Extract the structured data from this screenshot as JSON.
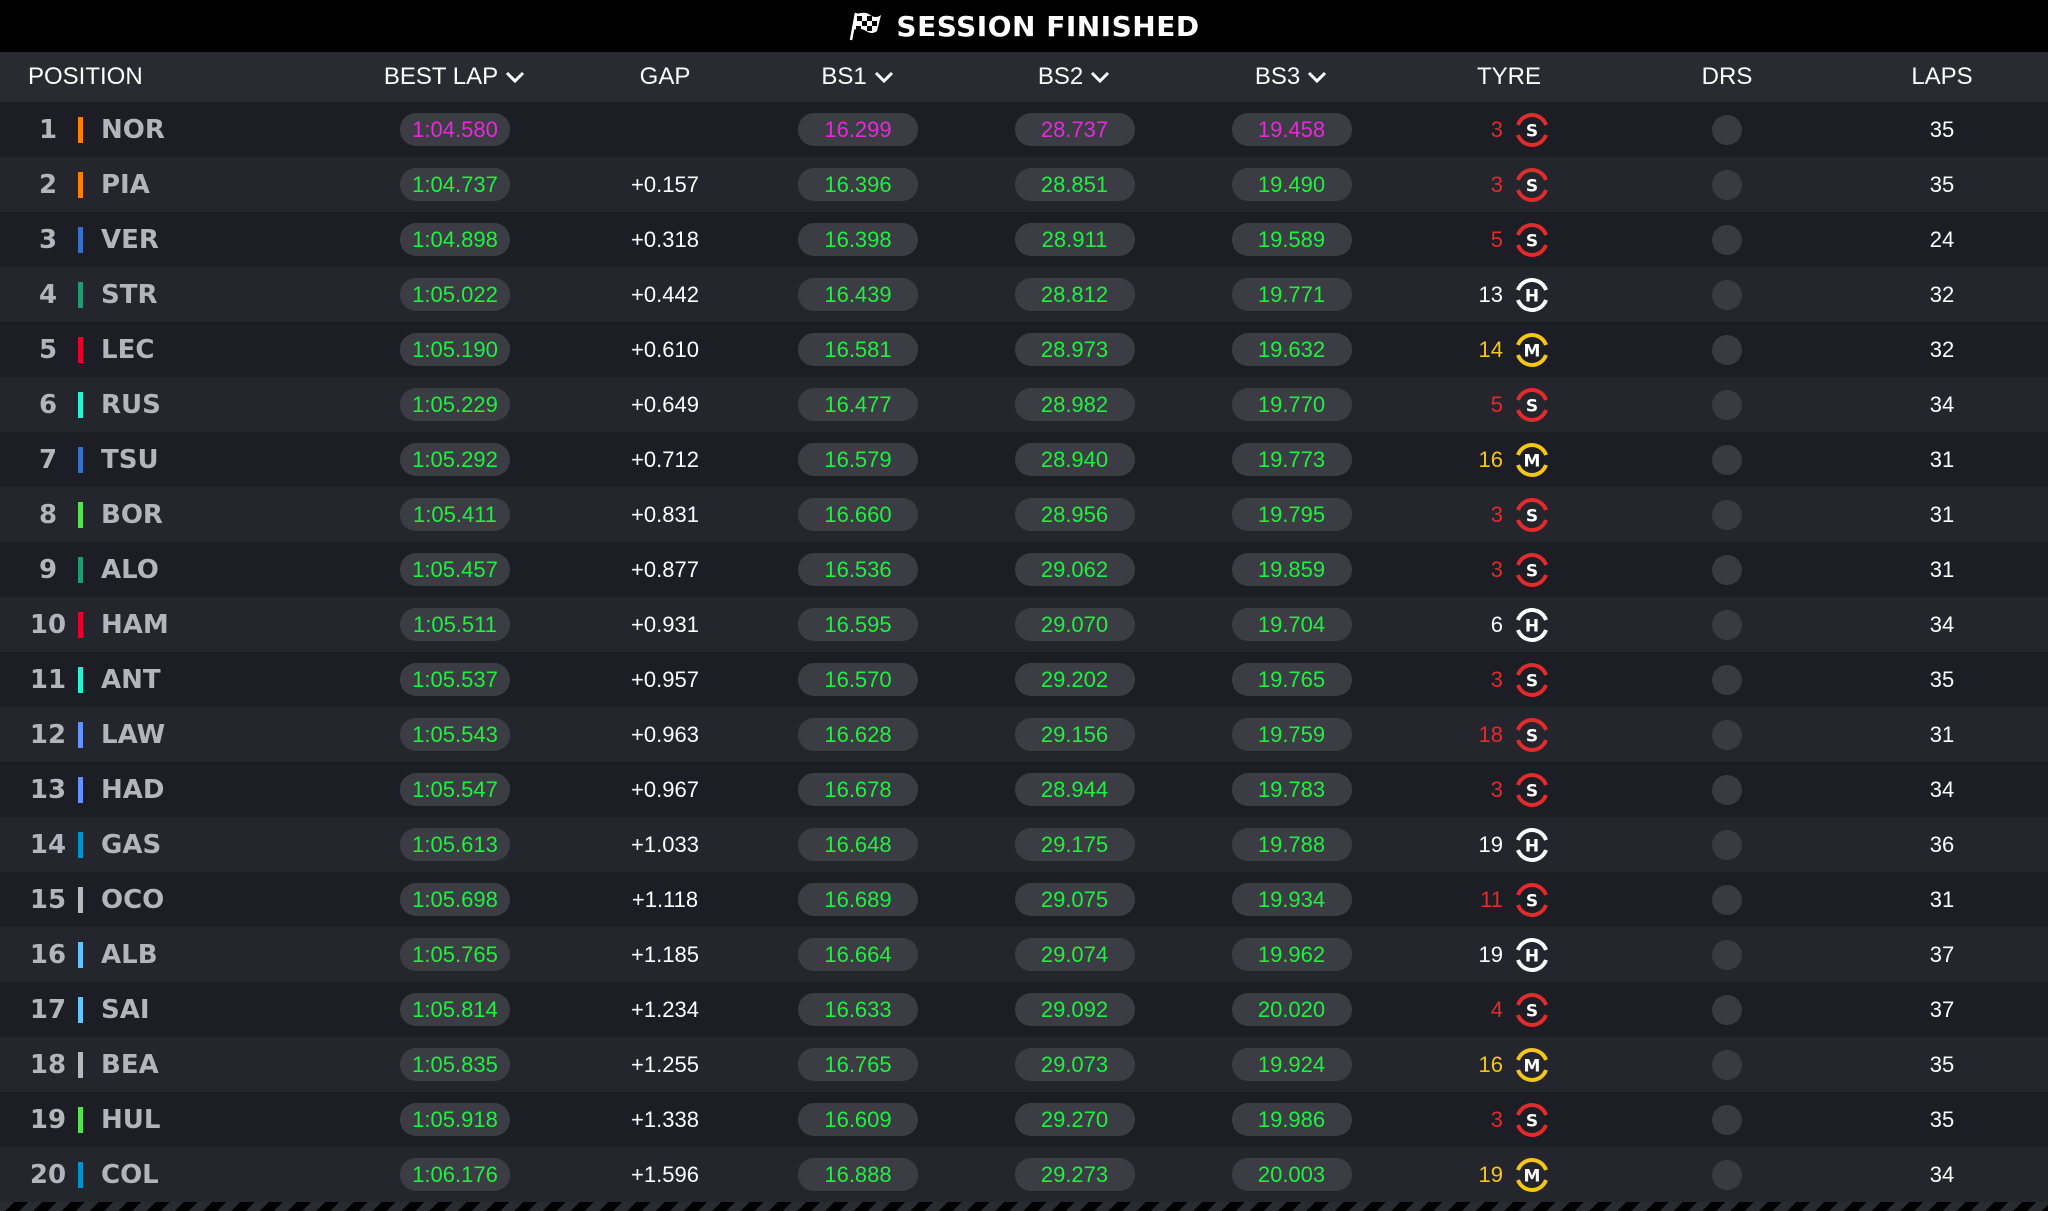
{
  "title": "SESSION FINISHED",
  "headers": {
    "position": "POSITION",
    "best_lap": "BEST LAP",
    "gap": "GAP",
    "bs1": "BS1",
    "bs2": "BS2",
    "bs3": "BS3",
    "tyre": "TYRE",
    "drs": "DRS",
    "laps": "LAPS"
  },
  "colors": {
    "green": "#1ff03f",
    "purple": "#e52ad9",
    "soft": "#e22b2b",
    "medium": "#f5c518",
    "hard": "#ffffff"
  },
  "drivers": [
    {
      "pos": "1",
      "code": "NOR",
      "team_color": "#ff8000",
      "best": "1:04.580",
      "best_purple": true,
      "gap": "",
      "bs1": "16.299",
      "bs1_purple": true,
      "bs2": "28.737",
      "bs2_purple": true,
      "bs3": "19.458",
      "bs3_purple": true,
      "tyre_age": "3",
      "tyre": "S",
      "laps": "35"
    },
    {
      "pos": "2",
      "code": "PIA",
      "team_color": "#ff8000",
      "best": "1:04.737",
      "gap": "+0.157",
      "bs1": "16.396",
      "bs2": "28.851",
      "bs3": "19.490",
      "tyre_age": "3",
      "tyre": "S",
      "laps": "35"
    },
    {
      "pos": "3",
      "code": "VER",
      "team_color": "#3671c6",
      "best": "1:04.898",
      "gap": "+0.318",
      "bs1": "16.398",
      "bs2": "28.911",
      "bs3": "19.589",
      "tyre_age": "5",
      "tyre": "S",
      "laps": "24"
    },
    {
      "pos": "4",
      "code": "STR",
      "team_color": "#229971",
      "best": "1:05.022",
      "gap": "+0.442",
      "bs1": "16.439",
      "bs2": "28.812",
      "bs3": "19.771",
      "tyre_age": "13",
      "tyre": "H",
      "laps": "32"
    },
    {
      "pos": "5",
      "code": "LEC",
      "team_color": "#e8002d",
      "best": "1:05.190",
      "gap": "+0.610",
      "bs1": "16.581",
      "bs2": "28.973",
      "bs3": "19.632",
      "tyre_age": "14",
      "tyre": "M",
      "laps": "32"
    },
    {
      "pos": "6",
      "code": "RUS",
      "team_color": "#27f4d2",
      "best": "1:05.229",
      "gap": "+0.649",
      "bs1": "16.477",
      "bs2": "28.982",
      "bs3": "19.770",
      "tyre_age": "5",
      "tyre": "S",
      "laps": "34"
    },
    {
      "pos": "7",
      "code": "TSU",
      "team_color": "#3671c6",
      "best": "1:05.292",
      "gap": "+0.712",
      "bs1": "16.579",
      "bs2": "28.940",
      "bs3": "19.773",
      "tyre_age": "16",
      "tyre": "M",
      "laps": "31"
    },
    {
      "pos": "8",
      "code": "BOR",
      "team_color": "#52e252",
      "best": "1:05.411",
      "gap": "+0.831",
      "bs1": "16.660",
      "bs2": "28.956",
      "bs3": "19.795",
      "tyre_age": "3",
      "tyre": "S",
      "laps": "31"
    },
    {
      "pos": "9",
      "code": "ALO",
      "team_color": "#229971",
      "best": "1:05.457",
      "gap": "+0.877",
      "bs1": "16.536",
      "bs2": "29.062",
      "bs3": "19.859",
      "tyre_age": "3",
      "tyre": "S",
      "laps": "31"
    },
    {
      "pos": "10",
      "code": "HAM",
      "team_color": "#e8002d",
      "best": "1:05.511",
      "gap": "+0.931",
      "bs1": "16.595",
      "bs2": "29.070",
      "bs3": "19.704",
      "tyre_age": "6",
      "tyre": "H",
      "laps": "34"
    },
    {
      "pos": "11",
      "code": "ANT",
      "team_color": "#27f4d2",
      "best": "1:05.537",
      "gap": "+0.957",
      "bs1": "16.570",
      "bs2": "29.202",
      "bs3": "19.765",
      "tyre_age": "3",
      "tyre": "S",
      "laps": "35"
    },
    {
      "pos": "12",
      "code": "LAW",
      "team_color": "#6692ff",
      "best": "1:05.543",
      "gap": "+0.963",
      "bs1": "16.628",
      "bs2": "29.156",
      "bs3": "19.759",
      "tyre_age": "18",
      "tyre": "S",
      "laps": "31"
    },
    {
      "pos": "13",
      "code": "HAD",
      "team_color": "#6692ff",
      "best": "1:05.547",
      "gap": "+0.967",
      "bs1": "16.678",
      "bs2": "28.944",
      "bs3": "19.783",
      "tyre_age": "3",
      "tyre": "S",
      "laps": "34"
    },
    {
      "pos": "14",
      "code": "GAS",
      "team_color": "#0093cc",
      "best": "1:05.613",
      "gap": "+1.033",
      "bs1": "16.648",
      "bs2": "29.175",
      "bs3": "19.788",
      "tyre_age": "19",
      "tyre": "H",
      "laps": "36"
    },
    {
      "pos": "15",
      "code": "OCO",
      "team_color": "#b6babd",
      "best": "1:05.698",
      "gap": "+1.118",
      "bs1": "16.689",
      "bs2": "29.075",
      "bs3": "19.934",
      "tyre_age": "11",
      "tyre": "S",
      "laps": "31"
    },
    {
      "pos": "16",
      "code": "ALB",
      "team_color": "#64c4ff",
      "best": "1:05.765",
      "gap": "+1.185",
      "bs1": "16.664",
      "bs2": "29.074",
      "bs3": "19.962",
      "tyre_age": "19",
      "tyre": "H",
      "laps": "37"
    },
    {
      "pos": "17",
      "code": "SAI",
      "team_color": "#64c4ff",
      "best": "1:05.814",
      "gap": "+1.234",
      "bs1": "16.633",
      "bs2": "29.092",
      "bs3": "20.020",
      "tyre_age": "4",
      "tyre": "S",
      "laps": "37"
    },
    {
      "pos": "18",
      "code": "BEA",
      "team_color": "#b6babd",
      "best": "1:05.835",
      "gap": "+1.255",
      "bs1": "16.765",
      "bs2": "29.073",
      "bs3": "19.924",
      "tyre_age": "16",
      "tyre": "M",
      "laps": "35"
    },
    {
      "pos": "19",
      "code": "HUL",
      "team_color": "#52e252",
      "best": "1:05.918",
      "gap": "+1.338",
      "bs1": "16.609",
      "bs2": "29.270",
      "bs3": "19.986",
      "tyre_age": "3",
      "tyre": "S",
      "laps": "35"
    },
    {
      "pos": "20",
      "code": "COL",
      "team_color": "#0093cc",
      "best": "1:06.176",
      "gap": "+1.596",
      "bs1": "16.888",
      "bs2": "29.273",
      "bs3": "20.003",
      "tyre_age": "19",
      "tyre": "M",
      "laps": "34"
    }
  ]
}
